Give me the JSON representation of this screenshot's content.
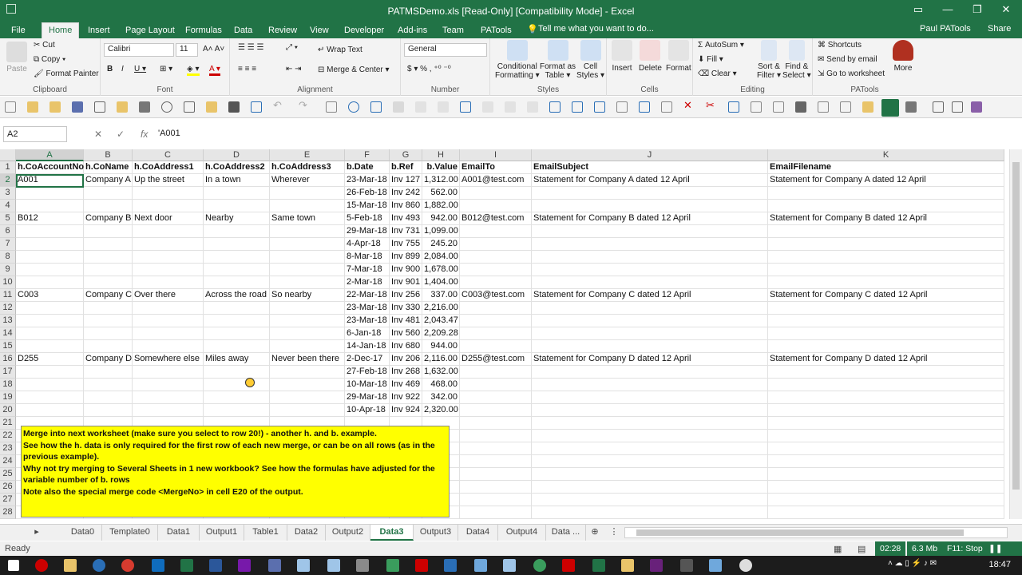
{
  "window": {
    "title": "PATMSDemo.xls  [Read-Only]  [Compatibility Mode] - Excel"
  },
  "ribbon_tabs": [
    "File",
    "Home",
    "Insert",
    "Page Layout",
    "Formulas",
    "Data",
    "Review",
    "View",
    "Developer",
    "Add-ins",
    "Team",
    "PATools"
  ],
  "tell_me": "Tell me what you want to do...",
  "user": "Paul PATools",
  "share": "Share",
  "clipboard": {
    "paste": "Paste",
    "cut": "Cut",
    "copy": "Copy",
    "format_painter": "Format Painter",
    "label": "Clipboard"
  },
  "font": {
    "name": "Calibri",
    "size": "11",
    "label": "Font"
  },
  "alignment": {
    "wrap": "Wrap Text",
    "merge": "Merge & Center",
    "label": "Alignment"
  },
  "number": {
    "format": "General",
    "label": "Number"
  },
  "styles": {
    "conditional": "Conditional",
    "conditional2": "Formatting",
    "format_as": "Format as",
    "format_as2": "Table",
    "cell": "Cell",
    "cell2": "Styles",
    "label": "Styles"
  },
  "cells": {
    "insert": "Insert",
    "delete": "Delete",
    "format": "Format",
    "label": "Cells"
  },
  "editing": {
    "autosum": "AutoSum",
    "fill": "Fill",
    "clear": "Clear",
    "sort": "Sort &",
    "sort2": "Filter",
    "find": "Find &",
    "find2": "Select",
    "label": "Editing"
  },
  "patools": {
    "shortcuts": "Shortcuts",
    "send_email": "Send by email",
    "goto": "Go to worksheet",
    "more": "More",
    "label": "PATools"
  },
  "formula_bar": {
    "name_box": "A2",
    "content": "'A001"
  },
  "columns": [
    "A",
    "B",
    "C",
    "D",
    "E",
    "F",
    "G",
    "H",
    "I",
    "J",
    "K"
  ],
  "rows": [
    [
      "h.CoAccountNo",
      "h.CoName",
      "h.CoAddress1",
      "h.CoAddress2",
      "h.CoAddress3",
      "b.Date",
      "b.Ref",
      "b.Value",
      "EmailTo",
      "EmailSubject",
      "EmailFilename"
    ],
    [
      "A001",
      "Company A",
      "Up the street",
      "In a town",
      "Wherever",
      "23-Mar-18",
      "Inv 127",
      "1,312.00",
      "A001@test.com",
      "Statement for Company A dated 12 April",
      "Statement for Company A dated 12 April"
    ],
    [
      "",
      "",
      "",
      "",
      "",
      "26-Feb-18",
      "Inv 242",
      "562.00",
      "",
      "",
      ""
    ],
    [
      "",
      "",
      "",
      "",
      "",
      "15-Mar-18",
      "Inv 860",
      "1,882.00",
      "",
      "",
      ""
    ],
    [
      "B012",
      "Company B",
      "Next door",
      "Nearby",
      "Same town",
      "5-Feb-18",
      "Inv 493",
      "942.00",
      "B012@test.com",
      "Statement for Company B dated 12 April",
      "Statement for Company B dated 12 April"
    ],
    [
      "",
      "",
      "",
      "",
      "",
      "29-Mar-18",
      "Inv 731",
      "1,099.00",
      "",
      "",
      ""
    ],
    [
      "",
      "",
      "",
      "",
      "",
      "4-Apr-18",
      "Inv 755",
      "245.20",
      "",
      "",
      ""
    ],
    [
      "",
      "",
      "",
      "",
      "",
      "8-Mar-18",
      "Inv 899",
      "2,084.00",
      "",
      "",
      ""
    ],
    [
      "",
      "",
      "",
      "",
      "",
      "7-Mar-18",
      "Inv 900",
      "1,678.00",
      "",
      "",
      ""
    ],
    [
      "",
      "",
      "",
      "",
      "",
      "2-Mar-18",
      "Inv 901",
      "1,404.00",
      "",
      "",
      ""
    ],
    [
      "C003",
      "Company C",
      "Over there",
      "Across the road",
      "So nearby",
      "22-Mar-18",
      "Inv 256",
      "337.00",
      "C003@test.com",
      "Statement for Company C dated 12 April",
      "Statement for Company C dated 12 April"
    ],
    [
      "",
      "",
      "",
      "",
      "",
      "23-Mar-18",
      "Inv 330",
      "2,216.00",
      "",
      "",
      ""
    ],
    [
      "",
      "",
      "",
      "",
      "",
      "23-Mar-18",
      "Inv 481",
      "2,043.47",
      "",
      "",
      ""
    ],
    [
      "",
      "",
      "",
      "",
      "",
      "6-Jan-18",
      "Inv 560",
      "2,209.28",
      "",
      "",
      ""
    ],
    [
      "",
      "",
      "",
      "",
      "",
      "14-Jan-18",
      "Inv 680",
      "944.00",
      "",
      "",
      ""
    ],
    [
      "D255",
      "Company D",
      "Somewhere else",
      "Miles away",
      "Never been there",
      "2-Dec-17",
      "Inv 206",
      "2,116.00",
      "D255@test.com",
      "Statement for Company D dated 12 April",
      "Statement for Company D dated 12 April"
    ],
    [
      "",
      "",
      "",
      "",
      "",
      "27-Feb-18",
      "Inv 268",
      "1,632.00",
      "",
      "",
      ""
    ],
    [
      "",
      "",
      "",
      "",
      "",
      "10-Mar-18",
      "Inv 469",
      "468.00",
      "",
      "",
      ""
    ],
    [
      "",
      "",
      "",
      "",
      "",
      "29-Mar-18",
      "Inv 922",
      "342.00",
      "",
      "",
      ""
    ],
    [
      "",
      "",
      "",
      "",
      "",
      "10-Apr-18",
      "Inv 924",
      "2,320.00",
      "",
      "",
      ""
    ],
    [
      "",
      "",
      "",
      "",
      "",
      "",
      "",
      "",
      "",
      "",
      ""
    ],
    [
      "",
      "",
      "",
      "",
      "",
      "",
      "",
      "",
      "",
      "",
      ""
    ],
    [
      "",
      "",
      "",
      "",
      "",
      "",
      "",
      "",
      "",
      "",
      ""
    ],
    [
      "",
      "",
      "",
      "",
      "",
      "",
      "",
      "",
      "",
      "",
      ""
    ],
    [
      "",
      "",
      "",
      "",
      "",
      "",
      "",
      "",
      "",
      "",
      ""
    ],
    [
      "",
      "",
      "",
      "",
      "",
      "",
      "",
      "",
      "",
      "",
      ""
    ],
    [
      "",
      "",
      "",
      "",
      "",
      "",
      "",
      "",
      "",
      "",
      ""
    ],
    [
      "",
      "",
      "",
      "",
      "",
      "",
      "",
      "",
      "",
      "",
      ""
    ]
  ],
  "note": [
    "Merge into next worksheet (make sure you select to row 20!) - another h. and b. example.",
    "See how the h. data is only required for the first row of each new merge, or can be on all rows (as in the previous example).",
    "Why not try merging to Several Sheets in 1 new workbook? See how the formulas have adjusted for the variable number of b. rows",
    "Note also the special merge code <MergeNo> in cell E20 of the output."
  ],
  "sheet_tabs": [
    "Data0",
    "Template0",
    "Data1",
    "Output1",
    "Table1",
    "Data2",
    "Output2",
    "Data3",
    "Output3",
    "Data4",
    "Output4",
    "Data ..."
  ],
  "active_sheet": "Data3",
  "status": {
    "ready": "Ready",
    "time": "02:28",
    "memory": "6.3 Mb",
    "stop": "F11: Stop"
  },
  "clock": "18:47",
  "accent": "#217346"
}
